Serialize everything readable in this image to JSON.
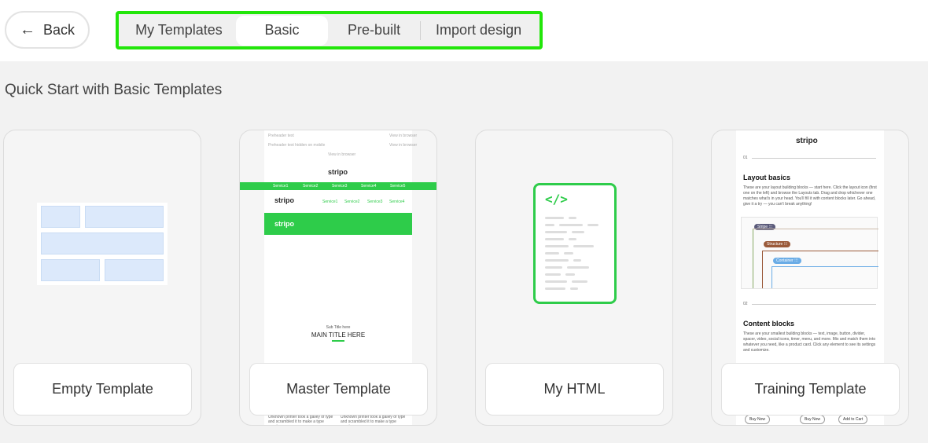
{
  "topbar": {
    "back_label": "Back",
    "tabs": [
      {
        "label": "My Templates",
        "active": false
      },
      {
        "label": "Basic",
        "active": true
      },
      {
        "label": "Pre-built",
        "active": false
      },
      {
        "label": "Import design",
        "active": false
      }
    ],
    "highlight_color": "#22e60a"
  },
  "section": {
    "title": "Quick Start with Basic Templates"
  },
  "cards": [
    {
      "label": "Empty Template"
    },
    {
      "label": "Master Template"
    },
    {
      "label": "My HTML"
    },
    {
      "label": "Training Template"
    }
  ],
  "master_preview": {
    "nav_items": [
      "Service1",
      "Service2",
      "Service3",
      "Service4",
      "Service5"
    ],
    "logo": "stripo",
    "subtitle": "Sub Title here",
    "main_title": "MAIN TITLE HERE",
    "footer_text": "Unknown printer took a galley of type and scrambled it to make a type specimen"
  },
  "html_preview": {
    "code_glyph": "</>"
  },
  "training_preview": {
    "logo": "stripo",
    "num1": "01",
    "heading1": "Layout basics",
    "para1": "These are your layout building blocks — start here. Click the layout icon (first one on the left) and browse the Layouts tab. Drag and drop whichever one matches what's in your head. You'll fill it with content blocks later. Go ahead, give it a try — you can't break anything!",
    "chips": [
      "Stripe ⁝⁝⁝",
      "Structure ⁝⁝⁝",
      "Container ⁝⁝⁝"
    ],
    "num2": "02",
    "heading2": "Content blocks",
    "para2": "These are your smallest building blocks — text, image, button, divider, spacer, video, social icons, timer, menu, and more. Mix and match them into whatever you need, like a product card. Click any element to see its settings and customize.",
    "buttons": [
      "Buy Now",
      "Buy Now",
      "Add to Cart"
    ]
  },
  "colors": {
    "brand_green": "#2ecc4a",
    "placeholder_blue": "#dce9fb"
  }
}
